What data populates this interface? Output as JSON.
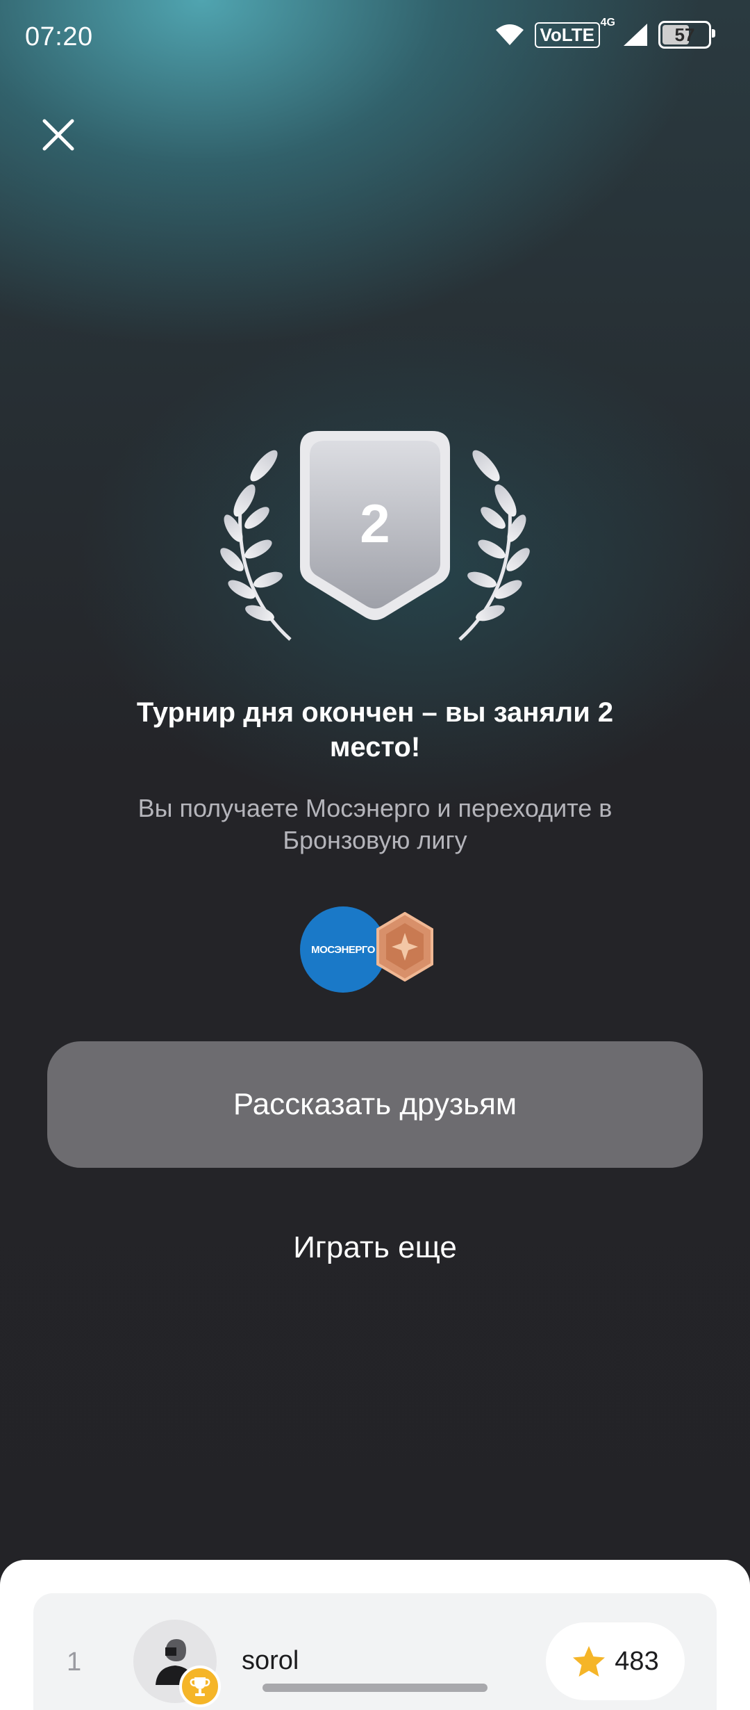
{
  "status_bar": {
    "time": "07:20",
    "network": "VoLTE",
    "network_gen": "4G",
    "battery": "57"
  },
  "result": {
    "place": "2",
    "title": "Турнир дня окончен – вы заняли 2 место!",
    "subtitle": "Вы получаете Мосэнерго и переходите в Бронзовую лигу"
  },
  "rewards": {
    "sponsor_logo_text": "МОСЭНЕРГО",
    "league": "bronze"
  },
  "actions": {
    "share_label": "Рассказать друзьям",
    "play_more_label": "Играть еще"
  },
  "leaderboard": {
    "rows": [
      {
        "rank": "1",
        "username": "sorol",
        "score": "483"
      }
    ]
  },
  "colors": {
    "accent_teal": "#52aab6",
    "share_button": "#6d6c70",
    "sponsor_blue": "#1a79c8",
    "bronze": "#d8906a",
    "star": "#f5b528"
  },
  "icons": [
    "close-icon",
    "wifi-icon",
    "signal-icon",
    "battery-icon",
    "laurel-icon",
    "trophy-icon",
    "star-icon",
    "avatar-icon"
  ]
}
